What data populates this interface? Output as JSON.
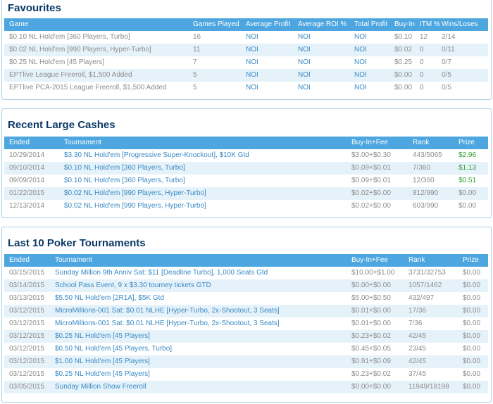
{
  "favourites": {
    "title": "Favourites",
    "headers": [
      "Game",
      "Games Played",
      "Average Profit",
      "Average ROI %",
      "Total Profit",
      "Buy-In",
      "ITM %",
      "Wins/Loses"
    ],
    "rows": [
      [
        "$0.10 NL Hold'em [360 Players, Turbo]",
        "16",
        "NOI",
        "NOI",
        "NOI",
        "$0.10",
        "12",
        "2/14"
      ],
      [
        "$0.02 NL Hold'em [990 Players, Hyper-Turbo]",
        "11",
        "NOI",
        "NOI",
        "NOI",
        "$0.02",
        "0",
        "0/11"
      ],
      [
        "$0.25 NL Hold'em [45 Players]",
        "7",
        "NOI",
        "NOI",
        "NOI",
        "$0.25",
        "0",
        "0/7"
      ],
      [
        "EPTlive League Freeroll, $1,500 Added",
        "5",
        "NOI",
        "NOI",
        "NOI",
        "$0.00",
        "0",
        "0/5"
      ],
      [
        "EPTlive PCA-2015 League Freeroll, $1,500 Added",
        "5",
        "NOI",
        "NOI",
        "NOI",
        "$0.00",
        "0",
        "0/5"
      ]
    ]
  },
  "recent_cashes": {
    "title": "Recent Large Cashes",
    "headers": [
      "Ended",
      "Tournament",
      "Buy-In+Fee",
      "Rank",
      "Prize"
    ],
    "rows": [
      [
        "10/29/2014",
        "$3.30 NL Hold'em [Progressive Super-Knockout], $10K Gtd",
        "$3.00+$0.30",
        "443/5065",
        "$2.96"
      ],
      [
        "09/10/2014",
        "$0.10 NL Hold'em [360 Players, Turbo]",
        "$0.09+$0.01",
        "7/360",
        "$1.13"
      ],
      [
        "09/09/2014",
        "$0.10 NL Hold'em [360 Players, Turbo]",
        "$0.09+$0.01",
        "12/360",
        "$0.51"
      ],
      [
        "01/22/2015",
        "$0.02 NL Hold'em [990 Players, Hyper-Turbo]",
        "$0.02+$0.00",
        "812/990",
        "$0.00"
      ],
      [
        "12/13/2014",
        "$0.02 NL Hold'em [990 Players, Hyper-Turbo]",
        "$0.02+$0.00",
        "603/990",
        "$0.00"
      ]
    ],
    "prize_colors": [
      "green",
      "green",
      "green",
      "gray",
      "gray"
    ]
  },
  "last_tournaments": {
    "title": "Last 10 Poker Tournaments",
    "headers": [
      "Ended",
      "Tournament",
      "Buy-In+Fee",
      "Rank",
      "Prize"
    ],
    "rows": [
      [
        "03/15/2015",
        "Sunday Million 9th Anniv Sat: $11 [Deadline Turbo], 1,000 Seats Gtd",
        "$10.00+$1.00",
        "3731/32753",
        "$0.00"
      ],
      [
        "03/14/2015",
        "School Pass Event, 9 x $3.30 tourney tickets GTD",
        "$0.00+$0.00",
        "1057/1462",
        "$0.00"
      ],
      [
        "03/13/2015",
        "$5.50 NL Hold'em [2R1A], $5K Gtd",
        "$5.00+$0.50",
        "432/497",
        "$0.00"
      ],
      [
        "03/12/2015",
        "MicroMillions-001 Sat: $0.01 NLHE [Hyper-Turbo, 2x-Shootout, 3 Seats]",
        "$0.01+$0.00",
        "17/36",
        "$0.00"
      ],
      [
        "03/12/2015",
        "MicroMillions-001 Sat: $0.01 NLHE [Hyper-Turbo, 2x-Shootout, 3 Seats]",
        "$0.01+$0.00",
        "7/36",
        "$0.00"
      ],
      [
        "03/12/2015",
        "$0.25 NL Hold'em [45 Players]",
        "$0.23+$0.02",
        "42/45",
        "$0.00"
      ],
      [
        "03/12/2015",
        "$0.50 NL Hold'em [45 Players, Turbo]",
        "$0.45+$0.05",
        "23/45",
        "$0.00"
      ],
      [
        "03/12/2015",
        "$1.00 NL Hold'em [45 Players]",
        "$0.91+$0.09",
        "42/45",
        "$0.00"
      ],
      [
        "03/12/2015",
        "$0.25 NL Hold'em [45 Players]",
        "$0.23+$0.02",
        "37/45",
        "$0.00"
      ],
      [
        "03/05/2015",
        "Sunday Million Show Freeroll",
        "$0.00+$0.00",
        "11949/18198",
        "$0.00"
      ]
    ]
  },
  "colors": {
    "header_bg": "#4da6df",
    "title": "#0b3a66",
    "link": "#3a8ac4",
    "prize_positive": "#2e9d2e",
    "row_alt": "#e6f2fa",
    "border": "#a8cde8"
  }
}
